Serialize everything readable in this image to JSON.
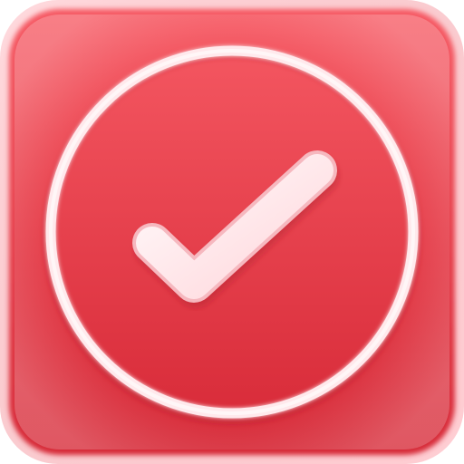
{
  "icon": {
    "name": "checkmark-icon",
    "colors": {
      "tile_top": "#f65a64",
      "tile_bottom": "#d62836",
      "bevel": "#ffd5da",
      "ring": "#ffe9ec",
      "check": "#fff0f2"
    }
  }
}
